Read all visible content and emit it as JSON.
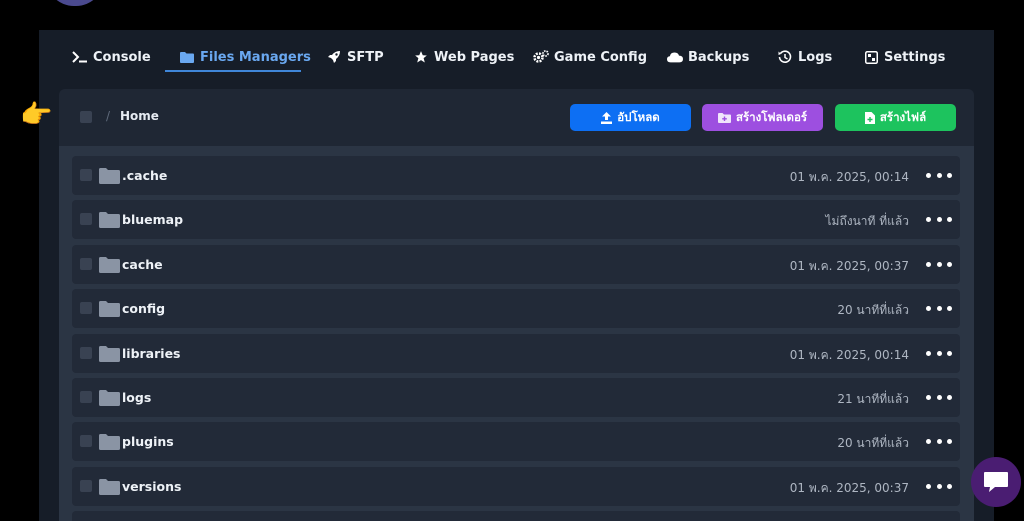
{
  "tabs": [
    {
      "label": "Console",
      "icon": "terminal-icon"
    },
    {
      "label": "Files Managers",
      "icon": "folder-icon",
      "active": true
    },
    {
      "label": "SFTP",
      "icon": "rocket-icon"
    },
    {
      "label": "Web Pages",
      "icon": "star-icon"
    },
    {
      "label": "Game Config",
      "icon": "gears-icon"
    },
    {
      "label": "Backups",
      "icon": "cloud-icon"
    },
    {
      "label": "Logs",
      "icon": "history-icon"
    },
    {
      "label": "Settings",
      "icon": "settings-icon"
    }
  ],
  "breadcrumb": {
    "separator": "/",
    "current": "Home"
  },
  "toolbar": {
    "upload_label": "อัปโหลด",
    "new_folder_label": "สร้างโฟลเดอร์",
    "new_file_label": "สร้างไฟล์"
  },
  "files": [
    {
      "name": ".cache",
      "modified": "01 พ.ค. 2025, 00:14"
    },
    {
      "name": "bluemap",
      "modified": "ไม่ถึงนาที ที่แล้ว"
    },
    {
      "name": "cache",
      "modified": "01 พ.ค. 2025, 00:37"
    },
    {
      "name": "config",
      "modified": "20 นาทีที่แล้ว"
    },
    {
      "name": "libraries",
      "modified": "01 พ.ค. 2025, 00:14"
    },
    {
      "name": "logs",
      "modified": "21 นาทีที่แล้ว"
    },
    {
      "name": "plugins",
      "modified": "20 นาทีที่แล้ว"
    },
    {
      "name": "versions",
      "modified": "01 พ.ค. 2025, 00:37"
    }
  ],
  "colors": {
    "accent": "#3f86d9",
    "upload": "#0d6ff3",
    "new_folder": "#9d4fe0",
    "new_file": "#1dc35e"
  }
}
